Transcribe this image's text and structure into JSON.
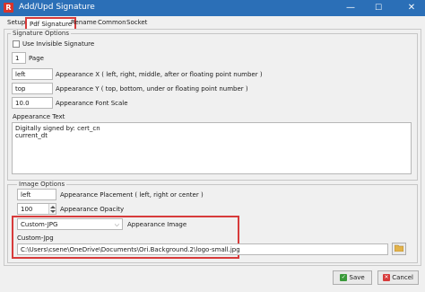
{
  "window": {
    "title": "Add/Upd Signature",
    "app_icon_letter": "R"
  },
  "title_buttons": {
    "minimize": "—",
    "maximize": "☐",
    "close": "✕"
  },
  "tabs": [
    "Setup",
    "Pdf Signature",
    "Rename",
    "Common",
    "Socket"
  ],
  "active_tab": "Pdf Signature",
  "signature_options": {
    "legend": "Signature Options",
    "invisible_label": "Use Invisible Signature",
    "page_value": "1",
    "page_label": "Page",
    "appearance_x_value": "left",
    "appearance_x_label": "Appearance X ( left, right, middle, after or floating point number )",
    "appearance_y_value": "top",
    "appearance_y_label": "Appearance Y ( top, bottom, under or floating point number )",
    "font_scale_value": "10.0",
    "font_scale_label": "Appearance Font Scale"
  },
  "appearance_text": {
    "label": "Appearance Text",
    "lines": "Digitally signed by: cert_cn\ncurrent_dt"
  },
  "image_options": {
    "legend": "Image Options",
    "placement_value": "left",
    "placement_label": "Appearance Placement ( left, right or center )",
    "opacity_value": "100",
    "opacity_label": "Appearance Opacity",
    "image_select_value": "Custom-JPG",
    "image_label": "Appearance Image",
    "custom_label": "Custom-Jpg",
    "custom_path": "C:\\Users\\csene\\OneDrive\\Documents\\Ori.Background.2\\logo-small.jpg"
  },
  "footer": {
    "save_label": "Save",
    "cancel_label": "Cancel"
  },
  "colors": {
    "titlebar": "#2b6fb7",
    "highlight": "#d73b3b",
    "save_icon": "#3a9a3a",
    "cancel_icon": "#d73b3b"
  }
}
